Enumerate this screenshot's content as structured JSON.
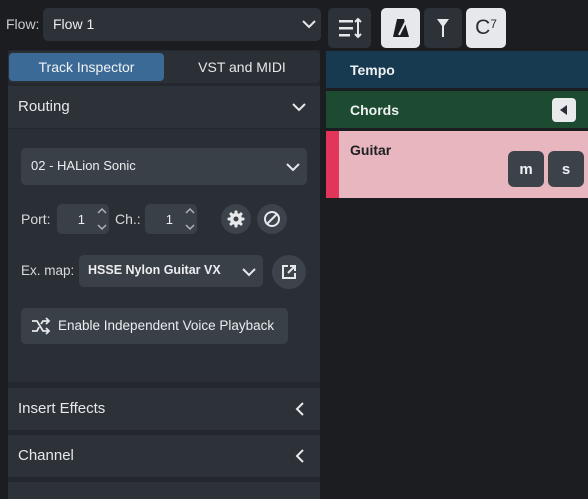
{
  "toolbar": {
    "flow_label": "Flow:",
    "flow_value": "Flow 1",
    "chord_button_base": "C",
    "chord_button_sup": "7"
  },
  "inspector": {
    "tabs": [
      "Track Inspector",
      "VST and MIDI"
    ],
    "routing": {
      "title": "Routing",
      "device": "02 - HALion Sonic",
      "port_label": "Port:",
      "port_value": "1",
      "channel_label": "Ch.:",
      "channel_value": "1",
      "exmap_label": "Ex. map:",
      "exmap_value": "HSSE Nylon Guitar VX",
      "voice_button": "Enable Independent Voice Playback"
    },
    "insert_effects_title": "Insert Effects",
    "channel_title": "Channel"
  },
  "tracks": {
    "tempo": "Tempo",
    "chords": "Chords",
    "guitar": "Guitar",
    "mute_label": "m",
    "solo_label": "s"
  },
  "colors": {
    "accent_tab": "#3b6a96",
    "tempo_track": "#173a51",
    "chords_track": "#1d4b32",
    "guitar_track": "#e7b6bf",
    "guitar_strip": "#e2355a"
  }
}
